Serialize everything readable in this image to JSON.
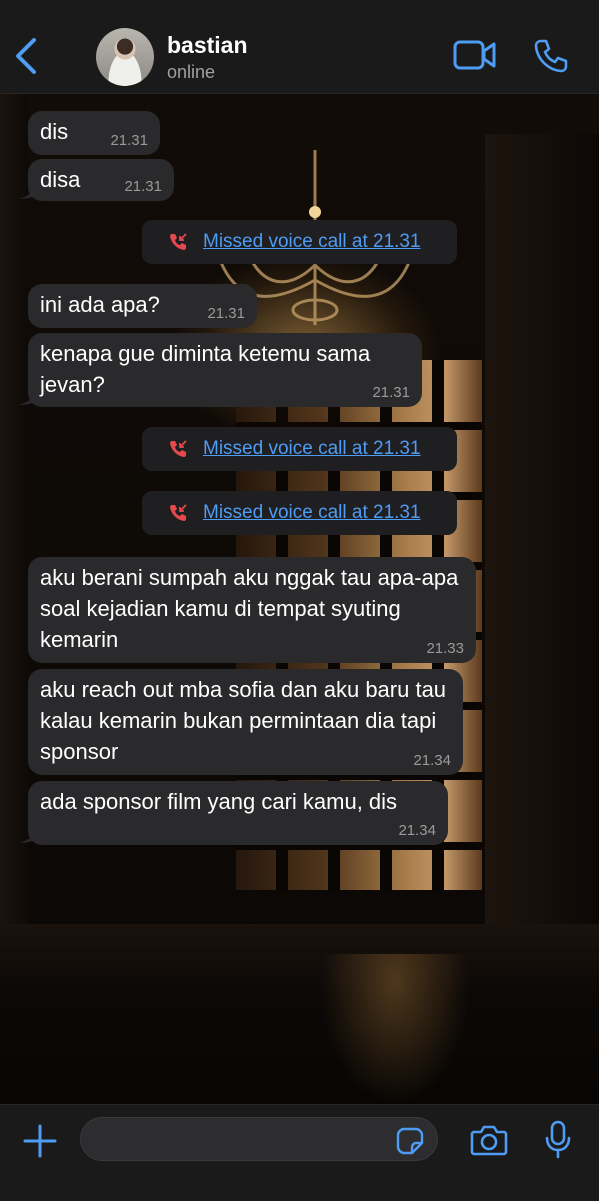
{
  "header": {
    "contact_name": "bastian",
    "status": "online",
    "icons": {
      "back": "chevron-left-icon",
      "video": "video-camera-icon",
      "phone": "phone-icon"
    }
  },
  "messages": [
    {
      "type": "incoming",
      "text": "dis",
      "time": "21.31"
    },
    {
      "type": "incoming",
      "text": "disa",
      "time": "21.31"
    },
    {
      "type": "missed_call",
      "text": "Missed voice call at 21.31"
    },
    {
      "type": "incoming",
      "text": "ini ada apa?",
      "time": "21.31"
    },
    {
      "type": "incoming",
      "text": "kenapa gue diminta ketemu sama jevan?",
      "time": "21.31"
    },
    {
      "type": "missed_call",
      "text": "Missed voice call at 21.31"
    },
    {
      "type": "missed_call",
      "text": "Missed voice call at 21.31"
    },
    {
      "type": "incoming",
      "text": "aku berani sumpah aku nggak tau apa-apa soal kejadian kamu di tempat syuting kemarin",
      "time": "21.33"
    },
    {
      "type": "incoming",
      "text": "aku reach out mba sofia dan aku baru tau kalau kemarin bukan permintaan dia tapi sponsor",
      "time": "21.34"
    },
    {
      "type": "incoming",
      "text": "ada sponsor film yang cari kamu, dis",
      "time": "21.34"
    }
  ],
  "input": {
    "placeholder": "",
    "icons": [
      "plus-icon",
      "sticker-icon",
      "camera-icon",
      "microphone-icon"
    ]
  },
  "colors": {
    "accent": "#4e9cf3",
    "missed_call": "#e5484d",
    "bubble": "#2a2a2c",
    "bar": "#1a1a1a"
  }
}
